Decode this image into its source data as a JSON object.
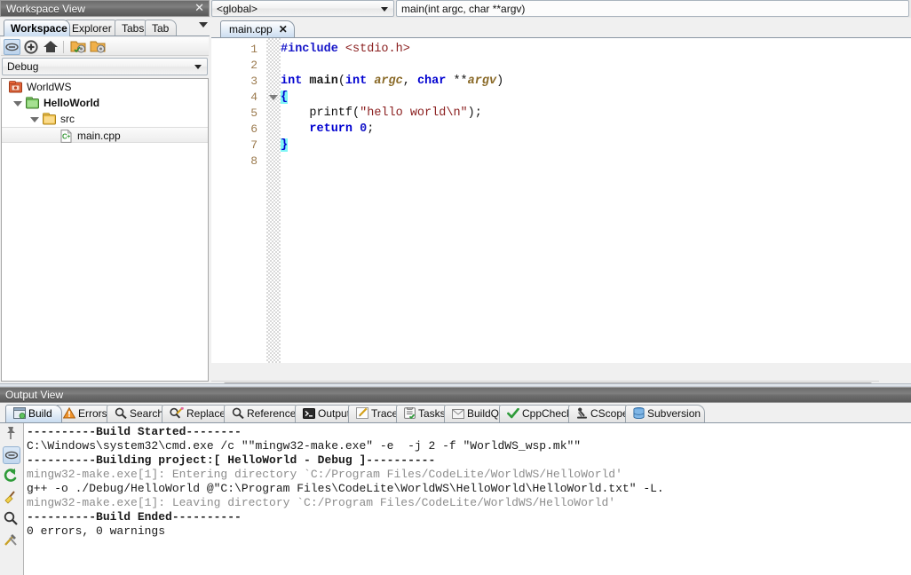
{
  "top": {
    "workspace_caption": "Workspace View",
    "close_glyph": "✕",
    "scope_value": "<global>",
    "signature_value": "main(int argc, char **argv)"
  },
  "sidebar": {
    "tabs": [
      {
        "label": "Workspace",
        "active": true
      },
      {
        "label": "Explorer",
        "active": false
      },
      {
        "label": "Tabs",
        "active": false
      },
      {
        "label": "Tab",
        "active": false
      }
    ],
    "overflow_name": "tabs-overflow-chevron",
    "toolbar": [
      {
        "name": "link-editor-icon",
        "pressed": true
      },
      {
        "name": "add-project-icon",
        "pressed": false
      },
      {
        "name": "home-icon",
        "pressed": false
      },
      {
        "name": "project-settings-icon",
        "pressed": false
      },
      {
        "name": "project-reload-icon",
        "pressed": false
      }
    ],
    "config_value": "Debug",
    "tree": [
      {
        "label": "WorldWS",
        "icon": "workspace-icon",
        "depth": 0,
        "bold": false,
        "selected": false,
        "expander": "none"
      },
      {
        "label": "HelloWorld",
        "icon": "project-folder-icon",
        "depth": 1,
        "bold": true,
        "selected": false,
        "expander": "open"
      },
      {
        "label": "src",
        "icon": "folder-icon",
        "depth": 2,
        "bold": false,
        "selected": false,
        "expander": "open"
      },
      {
        "label": "main.cpp",
        "icon": "cpp-file-icon",
        "depth": 3,
        "bold": false,
        "selected": true,
        "expander": "none"
      }
    ]
  },
  "editor": {
    "tab_label": "main.cpp",
    "tab_close_glyph": "✕",
    "line_numbers": [
      "1",
      "2",
      "3",
      "4",
      "5",
      "6",
      "7",
      "8"
    ],
    "fold_arrow_line": 4,
    "lines": [
      {
        "n": 1,
        "tokens": [
          {
            "t": "#include ",
            "c": "preproc"
          },
          {
            "t": "<stdio.h>",
            "c": "str"
          }
        ]
      },
      {
        "n": 2,
        "tokens": []
      },
      {
        "n": 3,
        "tokens": [
          {
            "t": "int ",
            "c": "kw"
          },
          {
            "t": "main",
            "c": "ident"
          },
          {
            "t": "(",
            "c": "plain"
          },
          {
            "t": "int ",
            "c": "kw"
          },
          {
            "t": "argc",
            "c": "param"
          },
          {
            "t": ", ",
            "c": "plain"
          },
          {
            "t": "char ",
            "c": "kw"
          },
          {
            "t": "**",
            "c": "plain"
          },
          {
            "t": "argv",
            "c": "param"
          },
          {
            "t": ")",
            "c": "plain"
          }
        ]
      },
      {
        "n": 4,
        "tokens": [
          {
            "t": "{",
            "c": "brace-hl"
          }
        ]
      },
      {
        "n": 5,
        "tokens": [
          {
            "t": "    printf(",
            "c": "plain"
          },
          {
            "t": "\"hello world\\n\"",
            "c": "str"
          },
          {
            "t": ");",
            "c": "plain"
          }
        ]
      },
      {
        "n": 6,
        "tokens": [
          {
            "t": "    ",
            "c": "plain"
          },
          {
            "t": "return ",
            "c": "kw"
          },
          {
            "t": "0",
            "c": "num"
          },
          {
            "t": ";",
            "c": "plain"
          }
        ]
      },
      {
        "n": 7,
        "tokens": [
          {
            "t": "}",
            "c": "brace-hl"
          }
        ]
      },
      {
        "n": 8,
        "tokens": []
      }
    ],
    "hscroll_name": "editor-horizontal-scrollbar"
  },
  "output": {
    "caption": "Output View",
    "tabs": [
      {
        "label": "Build",
        "icon": "build-icon",
        "active": true
      },
      {
        "label": "Errors",
        "icon": "warning-icon",
        "active": false
      },
      {
        "label": "Search",
        "icon": "search-icon",
        "active": false
      },
      {
        "label": "Replace",
        "icon": "replace-icon",
        "active": false
      },
      {
        "label": "References",
        "icon": "references-icon",
        "active": false
      },
      {
        "label": "Output",
        "icon": "console-icon",
        "active": false
      },
      {
        "label": "Trace",
        "icon": "trace-icon",
        "active": false
      },
      {
        "label": "Tasks",
        "icon": "tasks-icon",
        "active": false
      },
      {
        "label": "BuildQ",
        "icon": "envelope-icon",
        "active": false
      },
      {
        "label": "CppCheck",
        "icon": "check-icon",
        "active": false
      },
      {
        "label": "CScope",
        "icon": "cscope-icon",
        "active": false
      },
      {
        "label": "Subversion",
        "icon": "subversion-icon",
        "active": false
      }
    ],
    "sidebar_buttons": [
      {
        "name": "pin-icon",
        "pressed": false
      },
      {
        "name": "link-icon",
        "pressed": true
      },
      {
        "name": "repeat-icon",
        "pressed": false
      },
      {
        "name": "clear-broom-icon",
        "pressed": false
      },
      {
        "name": "find-icon",
        "pressed": false
      },
      {
        "name": "build-tools-icon",
        "pressed": false
      }
    ],
    "build_log": [
      {
        "text": "----------Build Started--------",
        "style": "b"
      },
      {
        "text": "C:\\Windows\\system32\\cmd.exe /c \"\"mingw32-make.exe\" -e  -j 2 -f \"WorldWS_wsp.mk\"\"",
        "style": ""
      },
      {
        "text": "----------Building project:[ HelloWorld - Debug ]----------",
        "style": "b"
      },
      {
        "text": "mingw32-make.exe[1]: Entering directory `C:/Program Files/CodeLite/WorldWS/HelloWorld'",
        "style": "dim"
      },
      {
        "text": "g++ -o ./Debug/HelloWorld @\"C:\\Program Files\\CodeLite\\WorldWS\\HelloWorld\\HelloWorld.txt\" -L.",
        "style": ""
      },
      {
        "text": "mingw32-make.exe[1]: Leaving directory `C:/Program Files/CodeLite/WorldWS/HelloWorld'",
        "style": "dim"
      },
      {
        "text": "----------Build Ended----------",
        "style": "b"
      },
      {
        "text": "0 errors, 0 warnings",
        "style": ""
      }
    ]
  },
  "colors": {
    "accent": "#c9dcf0",
    "caption_bg": "#6b6b6b",
    "keyword": "#0000d0",
    "string": "#8b2020",
    "brace_highlight": "#7ff5f5",
    "line_number": "#9b7a4e"
  }
}
